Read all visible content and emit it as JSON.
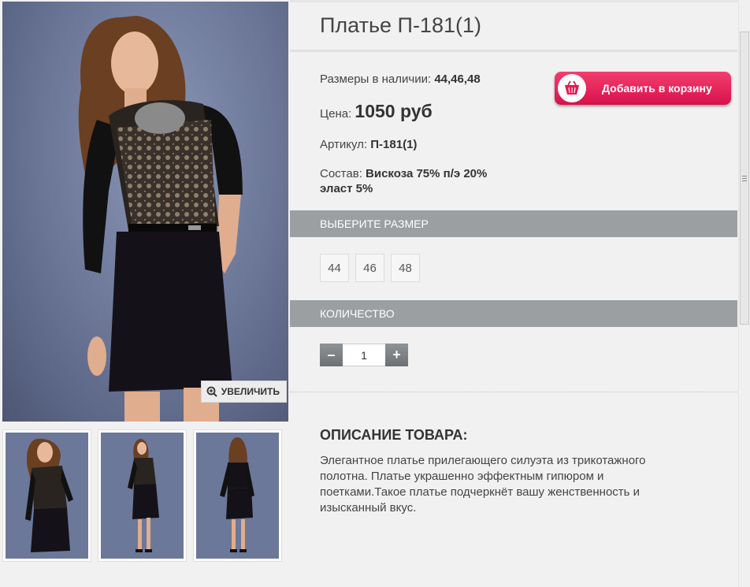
{
  "product": {
    "title": "Платье П-181(1)",
    "sizes_label": "Размеры в наличии:",
    "sizes_value": "44,46,48",
    "price_label": "Цена:",
    "price_value": "1050 руб",
    "sku_label": "Артикул:",
    "sku_value": "П-181(1)",
    "composition_label": "Состав:",
    "composition_value_1": "Вискоза 75% п/э 20%",
    "composition_value_2": "эласт 5%"
  },
  "cart": {
    "label": "Добавить в корзину",
    "icon": "basket-icon",
    "color": "#e8194f"
  },
  "zoom": {
    "label": "УВЕЛИЧИТЬ",
    "icon": "zoom-in-icon"
  },
  "size_section": {
    "title": "ВЫБЕРИТЕ РАЗМЕР",
    "options": [
      "44",
      "46",
      "48"
    ]
  },
  "qty_section": {
    "title": "КОЛИЧЕСТВО",
    "minus": "–",
    "plus": "+",
    "value": "1"
  },
  "description": {
    "title": "ОПИСАНИЕ ТОВАРА:",
    "text": "Элегантное платье прилегающего силуэта из трикотажного полотна. Платье украшенно эффектным гипюром и поетками.Такое платье подчеркнёт  вашу женственность и изысканный вкус."
  },
  "colors": {
    "section_bar": "#9b9fa2",
    "background": "#f1f1f1",
    "accent": "#e8194f"
  }
}
